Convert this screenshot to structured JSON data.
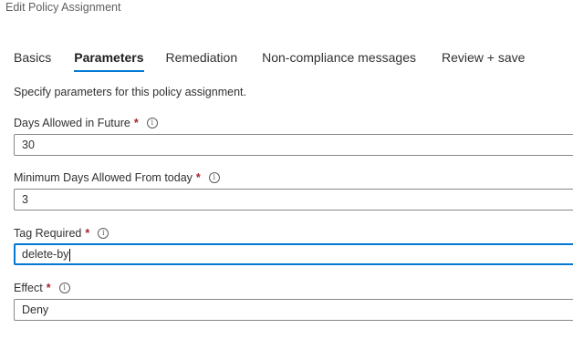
{
  "header": {
    "title": "Edit Policy Assignment"
  },
  "tabs": [
    {
      "label": "Basics",
      "active": false
    },
    {
      "label": "Parameters",
      "active": true
    },
    {
      "label": "Remediation",
      "active": false
    },
    {
      "label": "Non-compliance messages",
      "active": false
    },
    {
      "label": "Review + save",
      "active": false
    }
  ],
  "description": "Specify parameters for this policy assignment.",
  "fields": {
    "days_allowed_future": {
      "label": "Days Allowed in Future",
      "required_mark": "*",
      "info_icon": "info-icon",
      "value": "30"
    },
    "min_days_from_today": {
      "label": "Minimum Days Allowed From today",
      "required_mark": "*",
      "info_icon": "info-icon",
      "value": "3"
    },
    "tag_required": {
      "label": "Tag Required",
      "required_mark": "*",
      "info_icon": "info-icon",
      "value": "delete-by"
    },
    "effect": {
      "label": "Effect",
      "required_mark": "*",
      "info_icon": "info-icon",
      "value": "Deny"
    }
  },
  "colors": {
    "accent": "#0078d4",
    "required": "#a4262c",
    "text": "#323130",
    "border": "#8a8886"
  }
}
